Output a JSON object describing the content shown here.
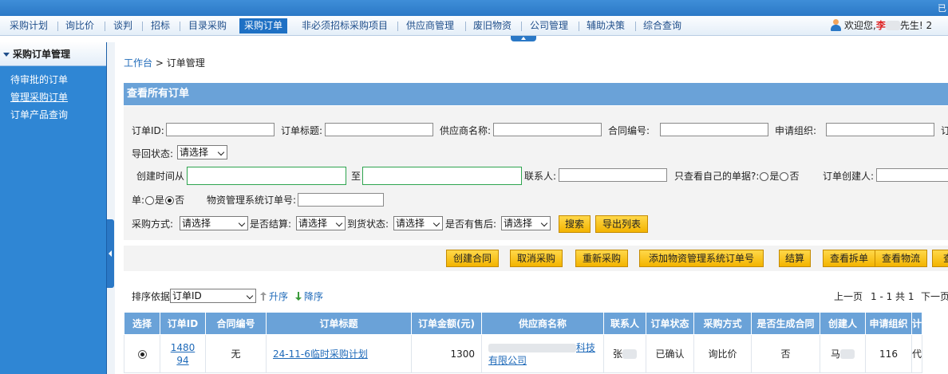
{
  "topbar": {
    "corner_text": "已"
  },
  "nav": {
    "items": [
      "采购计划",
      "询比价",
      "谈判",
      "招标",
      "目录采购",
      "采购订单",
      "非必须招标采购项目",
      "供应商管理",
      "废旧物资",
      "公司管理",
      "辅助决策",
      "综合查询"
    ],
    "active_index": 5
  },
  "user": {
    "greeting": "欢迎您,",
    "name": "李",
    "suffix": "先生!",
    "trailing": "2"
  },
  "sidebar": {
    "title": "采购订单管理",
    "items": [
      "待审批的订单",
      "管理采购订单",
      "订单产品查询"
    ],
    "current_index": 1
  },
  "breadcrumb": {
    "home": "工作台",
    "separator": ">",
    "current": "订单管理"
  },
  "panel": {
    "title": "查看所有订单"
  },
  "filters": {
    "order_id": "订单ID:",
    "order_title": "订单标题:",
    "supplier_name": "供应商名称:",
    "contract_no": "合同编号:",
    "apply_org": "申请组织:",
    "cut_label": "订",
    "return_status": "导回状态:",
    "return_status_value": "请选择",
    "created_from": "创建时间从",
    "to": "至",
    "contact": "联系人:",
    "only_mine": "只查看自己的单据?:",
    "yes": "是",
    "no": "否",
    "creator": "订单创建人:",
    "dan": "单:",
    "material_sys_no": "物资管理系统订单号:",
    "purchase_method": "采购方式:",
    "purchase_method_value": "请选择",
    "settled": "是否结算:",
    "settled_value": "请选择",
    "arrival_status": "到货状态:",
    "arrival_status_value": "请选择",
    "after_sale": "是否有售后:",
    "after_sale_value": "请选择",
    "search_btn": "搜索",
    "export_btn": "导出列表"
  },
  "actions": [
    "创建合同",
    "取消采购",
    "重新采购",
    "添加物资管理系统订单号",
    "结算",
    "查看拆单",
    "查看物流",
    "查"
  ],
  "sort": {
    "label": "排序依据",
    "value": "订单ID",
    "asc": "升序",
    "desc": "降序"
  },
  "pagination": {
    "prev": "上一页",
    "range": "1 - 1 共 1",
    "next": "下一页"
  },
  "table": {
    "headers": [
      "选择",
      "订单ID",
      "合同编号",
      "订单标题",
      "订单金额(元)",
      "供应商名称",
      "联系人",
      "订单状态",
      "采购方式",
      "是否生成合同",
      "创建人",
      "申请组织",
      "计"
    ],
    "rows": [
      {
        "order_id": "148094",
        "contract_no": "无",
        "title": "24-11-6临时采购计划",
        "amount": "1300",
        "supplier": "科技有限公司",
        "contact": "张",
        "status": "已确认",
        "method": "询比价",
        "contract_generated": "否",
        "creator": "马",
        "org": "116",
        "extra": "代"
      }
    ]
  }
}
